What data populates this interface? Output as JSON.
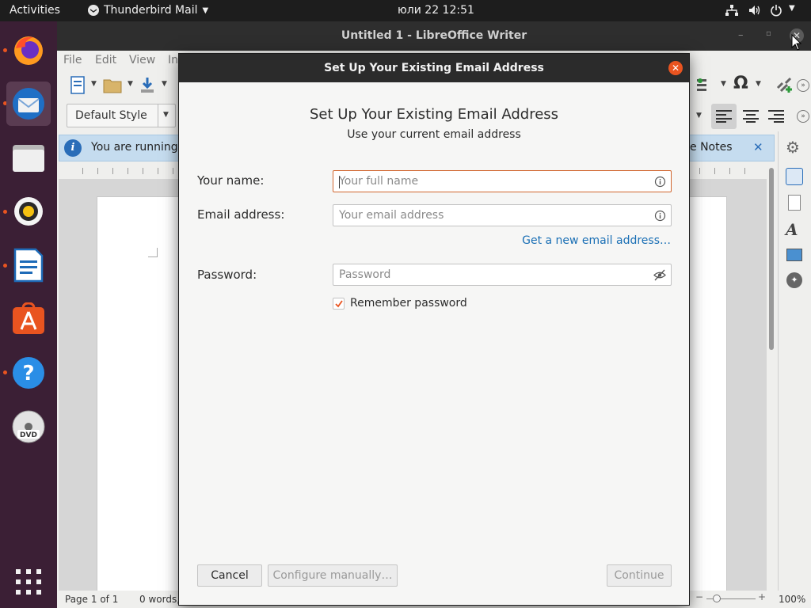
{
  "topbar": {
    "activities": "Activities",
    "app_menu": "Thunderbird Mail",
    "clock": "юли 22  12:51"
  },
  "writer": {
    "title": "Untitled 1 - LibreOffice Writer",
    "menu": [
      "File",
      "Edit",
      "View",
      "In"
    ],
    "para_style": "Default Style",
    "infobar_text": "You are running",
    "infobar_right": "e Notes",
    "status": {
      "page": "Page 1 of 1",
      "words": "0 words,",
      "zoom": "100%"
    }
  },
  "dialog": {
    "window_title": "Set Up Your Existing Email Address",
    "heading": "Set Up Your Existing Email Address",
    "subheading": "Use your current email address",
    "name_label": "Your name:",
    "name_placeholder": "Your full name",
    "email_label": "Email address:",
    "email_placeholder": "Your email address",
    "new_email_link": "Get a new email address…",
    "password_label": "Password:",
    "password_placeholder": "Password",
    "remember_label": "Remember password",
    "remember_checked": true,
    "cancel": "Cancel",
    "configure": "Configure manually…",
    "continue": "Continue"
  },
  "dock": [
    "firefox-icon",
    "thunderbird-icon",
    "files-icon",
    "rhythmbox-icon",
    "writer-icon",
    "software-icon",
    "help-icon",
    "dvd-icon",
    "apps-grid-icon"
  ],
  "colors": {
    "accent": "#e95420",
    "link": "#1a6fb5",
    "dock": "#3b1f35"
  }
}
